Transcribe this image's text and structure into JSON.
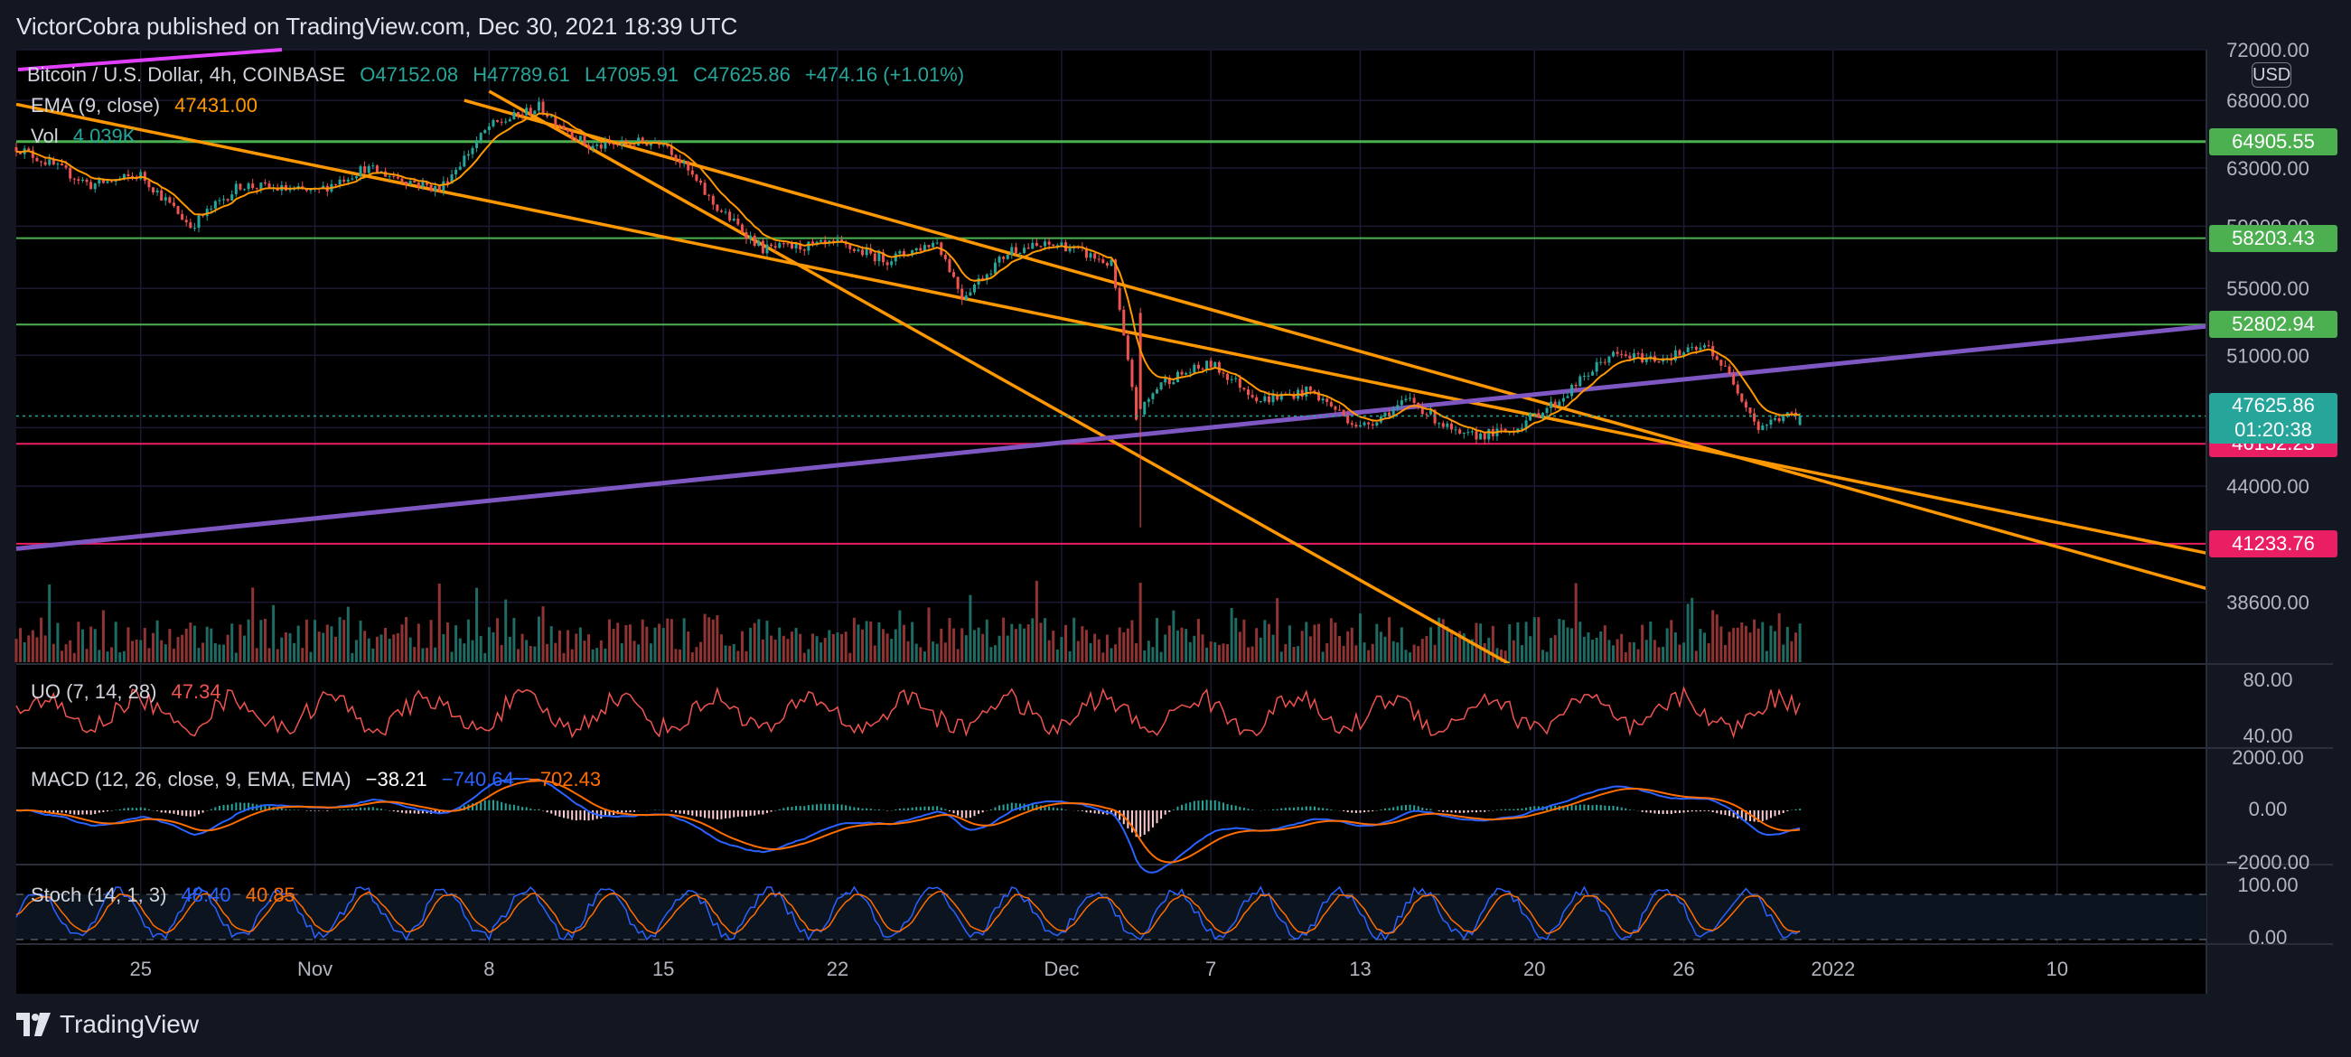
{
  "header": {
    "publisher": "VictorCobra",
    "published_text": "published on TradingView.com, Dec 30, 2021 18:39 UTC"
  },
  "footer": {
    "brand": "TradingView"
  },
  "legend": {
    "symbol": "Bitcoin / U.S. Dollar, 4h, COINBASE",
    "open": "O47152.08",
    "high": "H47789.61",
    "low": "L47095.91",
    "close": "C47625.86",
    "change": "+474.16 (+1.01%)",
    "ema_label": "EMA (9, close)",
    "ema_value": "47431.00",
    "vol_label": "Vol",
    "vol_value": "4.039K"
  },
  "currency_button": "USD",
  "price_axis": {
    "ticks": [
      {
        "v": 72000,
        "label": "72000.00"
      },
      {
        "v": 68000,
        "label": "68000.00"
      },
      {
        "v": 63000,
        "label": "63000.00"
      },
      {
        "v": 59000,
        "label": "59000.00"
      },
      {
        "v": 55000,
        "label": "55000.00"
      },
      {
        "v": 51000,
        "label": "51000.00"
      },
      {
        "v": 47000,
        "label": "47000.00"
      },
      {
        "v": 44000,
        "label": "44000.00"
      },
      {
        "v": 38600,
        "label": "38600.00"
      }
    ]
  },
  "level_lines": [
    {
      "price": 64905.55,
      "label": "64905.55",
      "color": "#4caf50"
    },
    {
      "price": 58203.43,
      "label": "58203.43",
      "color": "#4caf50"
    },
    {
      "price": 52802.94,
      "label": "52802.94",
      "color": "#4caf50"
    },
    {
      "price": 46152.23,
      "label": "46152.23",
      "color": "#e91e63"
    },
    {
      "price": 41233.76,
      "label": "41233.76",
      "color": "#e91e63"
    }
  ],
  "current_price": {
    "label": "47625.86",
    "countdown": "01:20:38",
    "color": "#26a69a"
  },
  "time_axis": {
    "labels": [
      "25",
      "Nov",
      "8",
      "15",
      "22",
      "Dec",
      "7",
      "13",
      "20",
      "26",
      "2022",
      "10"
    ]
  },
  "indicators": {
    "uo": {
      "label": "UO (7, 14, 28)",
      "value": "47.34",
      "ticks": [
        "80.00",
        "40.00"
      ]
    },
    "macd": {
      "label": "MACD (12, 26, close, 9, EMA, EMA)",
      "v1": "−38.21",
      "v2": "−740.64",
      "v3": "−702.43",
      "ticks": [
        "2000.00",
        "0.00",
        "−2000.00"
      ]
    },
    "stoch": {
      "label": "Stoch (14, 1, 3)",
      "v1": "48.40",
      "v2": "40.85",
      "ticks": [
        "100.00",
        "0.00"
      ]
    }
  },
  "colors": {
    "bull": "#26a69a",
    "bear": "#ef5350",
    "ema": "#ff9800",
    "trend": "#ff9800",
    "diag": "#7e57c2",
    "magenta": "#e040fb"
  },
  "chart_data": {
    "type": "candlestick",
    "symbol": "Bitcoin / U.S. Dollar, 4h, COINBASE",
    "timeframe": "4h",
    "x_range": [
      "2021-10-20",
      "2022-01-16"
    ],
    "y_range": [
      36000,
      72000
    ],
    "last": {
      "open": 47152.08,
      "high": 47789.61,
      "low": 47095.91,
      "close": 47625.86,
      "change": 474.16,
      "change_pct": 1.01
    },
    "path_approx": [
      [
        "2021-10-20",
        64500
      ],
      [
        "2021-10-23",
        61800
      ],
      [
        "2021-10-25",
        62500
      ],
      [
        "2021-10-27",
        59000
      ],
      [
        "2021-10-29",
        61800
      ],
      [
        "2021-11-01",
        61300
      ],
      [
        "2021-11-03",
        63000
      ],
      [
        "2021-11-06",
        61500
      ],
      [
        "2021-11-08",
        66000
      ],
      [
        "2021-11-10",
        67500
      ],
      [
        "2021-11-12",
        64500
      ],
      [
        "2021-11-15",
        65000
      ],
      [
        "2021-11-17",
        60500
      ],
      [
        "2021-11-19",
        57500
      ],
      [
        "2021-11-22",
        57800
      ],
      [
        "2021-11-24",
        56800
      ],
      [
        "2021-11-26",
        58000
      ],
      [
        "2021-11-27",
        54500
      ],
      [
        "2021-11-29",
        57500
      ],
      [
        "2021-12-01",
        57800
      ],
      [
        "2021-12-03",
        56500
      ],
      [
        "2021-12-04",
        47500
      ],
      [
        "2021-12-05",
        49500
      ],
      [
        "2021-12-07",
        50500
      ],
      [
        "2021-12-09",
        48500
      ],
      [
        "2021-12-11",
        49000
      ],
      [
        "2021-12-13",
        47000
      ],
      [
        "2021-12-15",
        48500
      ],
      [
        "2021-12-17",
        46500
      ],
      [
        "2021-12-19",
        46800
      ],
      [
        "2021-12-21",
        48500
      ],
      [
        "2021-12-23",
        51000
      ],
      [
        "2021-12-25",
        50800
      ],
      [
        "2021-12-27",
        51500
      ],
      [
        "2021-12-28",
        49500
      ],
      [
        "2021-12-29",
        47000
      ],
      [
        "2021-12-30",
        47625.86
      ]
    ],
    "ema": {
      "label": "EMA (9, close)",
      "last": 47431.0
    },
    "volume": {
      "label": "Vol",
      "last": "4.039K"
    },
    "horizontal_levels": [
      64905.55,
      58203.43,
      52802.94,
      46152.23,
      41233.76
    ],
    "trendlines": [
      {
        "color": "orange",
        "from": [
          "2021-10-20",
          67700
        ],
        "to": [
          "2022-01-16",
          40800
        ]
      },
      {
        "color": "orange",
        "from": [
          "2021-11-08",
          68700
        ],
        "to": [
          "2021-12-19",
          36000
        ]
      },
      {
        "color": "orange",
        "from": [
          "2021-11-07",
          68000
        ],
        "to": [
          "2022-01-16",
          39200
        ]
      },
      {
        "color": "purple",
        "from": [
          "2021-10-20",
          41000
        ],
        "to": [
          "2022-01-16",
          52700
        ]
      }
    ],
    "subcharts": {
      "ultimate_oscillator": {
        "params": [
          7,
          14,
          28
        ],
        "last": 47.34
      },
      "macd": {
        "params": [
          12,
          26,
          9
        ],
        "values": [
          -38.21,
          -740.64,
          -702.43
        ]
      },
      "stochastic": {
        "params": [
          14,
          1,
          3
        ],
        "k": 48.4,
        "d": 40.85
      }
    }
  }
}
